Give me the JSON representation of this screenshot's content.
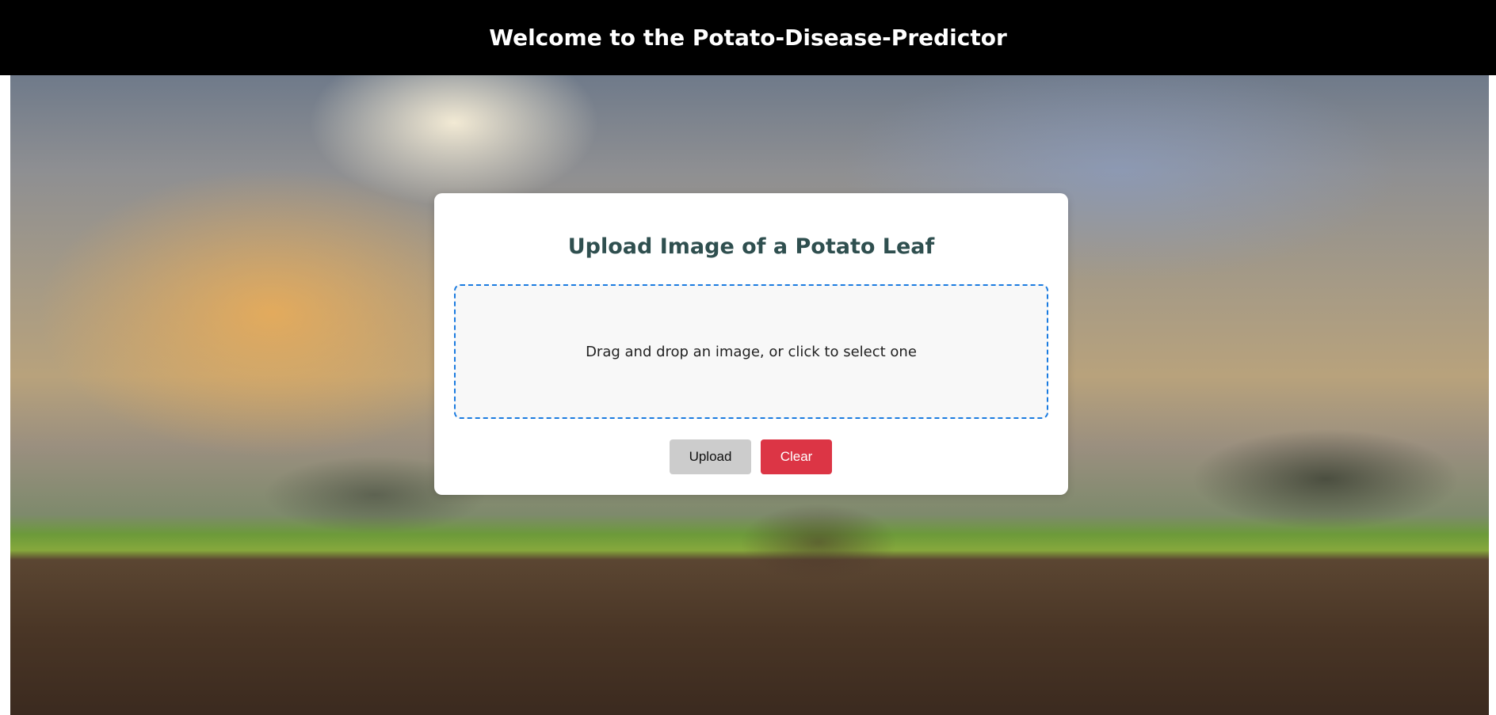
{
  "header": {
    "title": "Welcome to the Potato-Disease-Predictor"
  },
  "upload_card": {
    "heading": "Upload Image of a Potato Leaf",
    "dropzone_text": "Drag and drop an image, or click to select one",
    "upload_label": "Upload",
    "clear_label": "Clear"
  },
  "colors": {
    "header_bg": "#000000",
    "heading_color": "#2f4f4f",
    "dropzone_border": "#1a7be0",
    "upload_button_bg": "#cccccc",
    "clear_button_bg": "#dc3545"
  }
}
